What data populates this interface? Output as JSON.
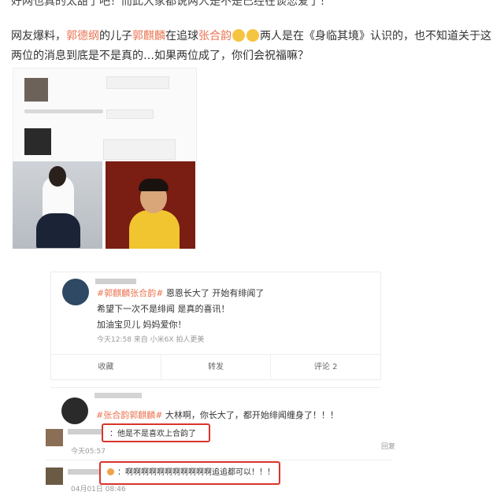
{
  "article": {
    "top_cut_text": "好网也真的太甜了吧！而此大家都说两人是不是已经在谈恋爱了！",
    "post_parts": {
      "p1": "网友爆料，",
      "name1": "郭德纲",
      "p2": "的儿子",
      "name2": "郭麒麟",
      "p3": "在追球",
      "name3": "张合韵",
      "p4": "两人是在《身临其境》认识的，也不知道关于这两位的消息到底是不是真的…如果两位成了，你们会祝福嘛？"
    }
  },
  "weibo_card": {
    "hashtag": "#郭麒麟张合韵#",
    "line1_rest": " 恩恩长大了 开始有绯闻了",
    "line2": "希望下一次不是绯闻 是真的喜讯！",
    "line3": "加油宝贝儿 妈妈爱你！",
    "meta": "今天12:58 来自 小米6X 拍人更美",
    "actions": [
      "收藏",
      "转发",
      "评论 2"
    ]
  },
  "second_card": {
    "hashtag": "#张合韵郭麒麟#",
    "rest": " 大林啊，你长大了，都开始绯闻缠身了！！！"
  },
  "comments": [
    {
      "text": "：他是不是喜欢上合韵了",
      "time": "今天05:57"
    },
    {
      "text": "：啊啊啊啊啊啊啊啊啊啊啊追追都可以！！！",
      "time": "04月01日 08:46"
    }
  ],
  "right_cut": "回复"
}
